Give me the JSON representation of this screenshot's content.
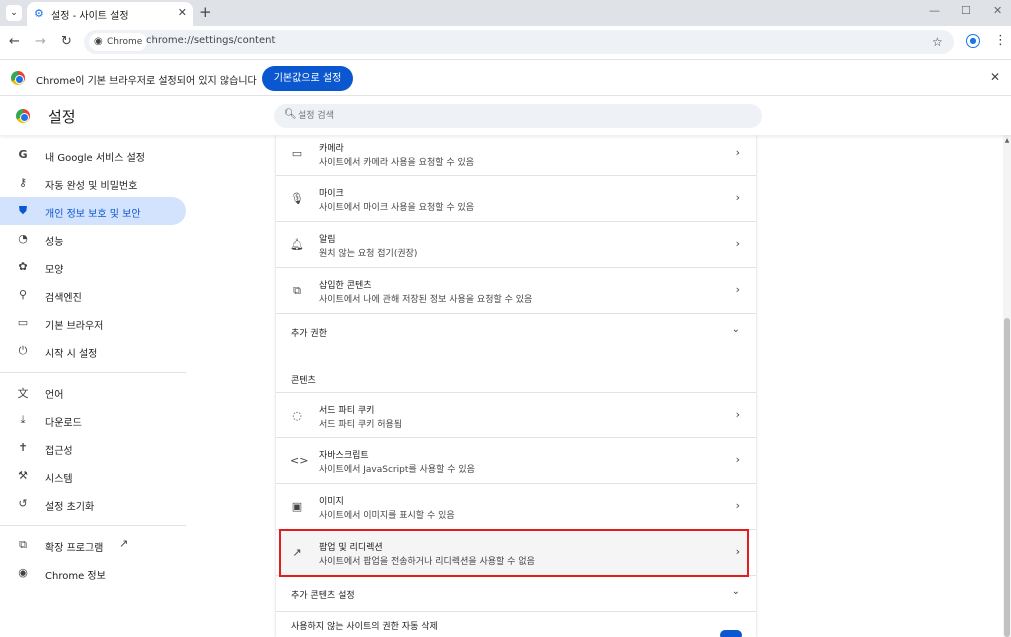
{
  "browser": {
    "tab_title": "설정 - 사이트 설정",
    "chip_label": "Chrome",
    "url": "chrome://settings/content"
  },
  "infobar": {
    "message": "Chrome이 기본 브라우저로 설정되어 있지 않습니다",
    "button_label": "기본값으로 설정"
  },
  "header": {
    "title": "설정",
    "search_placeholder": "설정 검색"
  },
  "sidebar": {
    "items": [
      {
        "label": "내 Google 서비스 설정"
      },
      {
        "label": "자동 완성 및 비밀번호"
      },
      {
        "label": "개인 정보 보호 및 보안"
      },
      {
        "label": "성능"
      },
      {
        "label": "모양"
      },
      {
        "label": "검색엔진"
      },
      {
        "label": "기본 브라우저"
      },
      {
        "label": "시작 시 설정"
      },
      {
        "label": "언어"
      },
      {
        "label": "다운로드"
      },
      {
        "label": "접근성"
      },
      {
        "label": "시스템"
      },
      {
        "label": "설정 초기화"
      },
      {
        "label": "확장 프로그램"
      },
      {
        "label": "Chrome 정보"
      }
    ],
    "active_index": 2
  },
  "main": {
    "permissions": [
      {
        "title": "카메라",
        "subtitle": "사이트에서 카메라 사용을 요청할 수 있음",
        "icon": "camera-icon"
      },
      {
        "title": "마이크",
        "subtitle": "사이트에서 마이크 사용을 요청할 수 있음",
        "icon": "mic-icon"
      },
      {
        "title": "알림",
        "subtitle": "원치 않는 요청 접기(권장)",
        "icon": "bell-icon"
      },
      {
        "title": "삽입한 콘텐츠",
        "subtitle": "사이트에서 나에 관해 저장된 정보 사용을 요청할 수 있음",
        "icon": "embedded-content-icon"
      }
    ],
    "additional_permissions_label": "추가 권한",
    "content_section_label": "콘텐츠",
    "content": [
      {
        "title": "서드 파티 쿠키",
        "subtitle": "서드 파티 쿠키 허용됨",
        "icon": "cookie-icon"
      },
      {
        "title": "자바스크립트",
        "subtitle": "사이트에서 JavaScript를 사용할 수 있음",
        "icon": "code-icon"
      },
      {
        "title": "이미지",
        "subtitle": "사이트에서 이미지를 표시할 수 있음",
        "icon": "image-icon"
      },
      {
        "title": "팝업 및 리디렉션",
        "subtitle": "사이트에서 팝업을 전송하거나 리디렉션을 사용할 수 없음",
        "icon": "popup-icon"
      }
    ],
    "additional_content_label": "추가 콘텐츠 설정",
    "auto_revoke_title": "사용하지 않는 사이트의 권한 자동 삭제"
  },
  "colors": {
    "accent": "#0b57d0",
    "active_nav_bg": "#d3e3fd",
    "highlight_border": "#e01e1e"
  }
}
